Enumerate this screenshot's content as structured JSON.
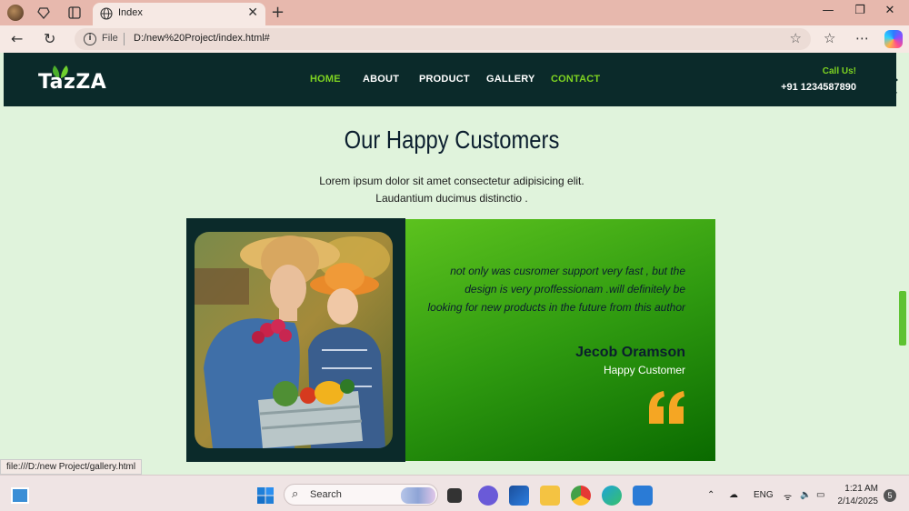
{
  "browser": {
    "tab_title": "Index",
    "tab_close": "✕",
    "new_tab": "+",
    "address_prefix": "File",
    "url": "D:/new%20Project/index.html#",
    "status_url": "file:///D:/new Project/gallery.html"
  },
  "site": {
    "logo": "TazZA",
    "nav": [
      "HOME",
      "ABOUT",
      "PRODUCT",
      "GALLERY",
      "CONTACT"
    ],
    "active_nav": "HOME",
    "call_label": "Call Us!",
    "phone": "+91 1234587890"
  },
  "section": {
    "title": "Our Happy Customers",
    "lead_line1": "Lorem ipsum dolor sit amet consectetur adipisicing elit.",
    "lead_line2": "Laudantium ducimus distinctio ."
  },
  "testimonial": {
    "quote": "not only was cusromer support very fast , but the design is very proffessionam .will definitely be looking for new products in the future from this author",
    "name": "Jecob Oramson",
    "role": "Happy Customer"
  },
  "taskbar": {
    "search_label": "Search",
    "lang": "ENG",
    "time": "1:21 AM",
    "date": "2/14/2025",
    "notifications": "5"
  },
  "colors": {
    "header_bg": "#0b2a2a",
    "accent_green": "#7ed321",
    "page_bg": "#e0f3dc",
    "quote_icon": "#f5a623"
  }
}
